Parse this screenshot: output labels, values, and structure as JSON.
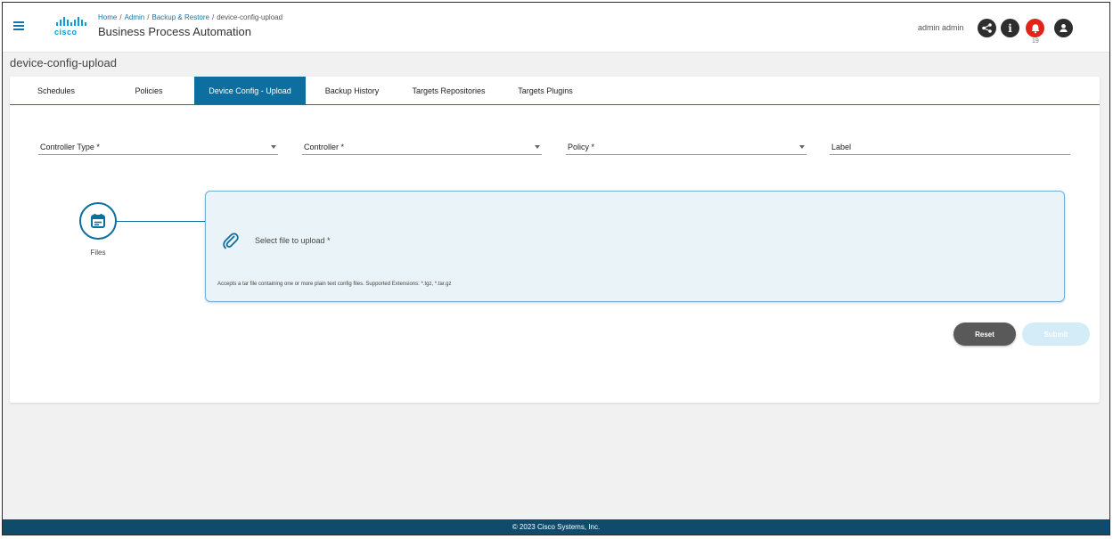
{
  "header": {
    "breadcrumb": {
      "home": "Home",
      "admin": "Admin",
      "backup_restore": "Backup & Restore",
      "current": "device-config-upload",
      "separator": "/"
    },
    "logo_text": "cisco",
    "app_title": "Business Process Automation",
    "user_name": "admin admin",
    "notification_count": "19",
    "info_glyph": "i",
    "icons": [
      "menu-icon",
      "share-icon",
      "info-icon",
      "bell-icon",
      "user-icon"
    ]
  },
  "page": {
    "title": "device-config-upload"
  },
  "tabs": [
    {
      "label": "Schedules",
      "active": false
    },
    {
      "label": "Policies",
      "active": false
    },
    {
      "label": "Device Config - Upload",
      "active": true
    },
    {
      "label": "Backup History",
      "active": false
    },
    {
      "label": "Targets Repositories",
      "active": false
    },
    {
      "label": "Targets Plugins",
      "active": false
    }
  ],
  "form": {
    "controller_type": {
      "label": "Controller Type *",
      "value": ""
    },
    "controller": {
      "label": "Controller *",
      "value": ""
    },
    "policy": {
      "label": "Policy *",
      "value": ""
    },
    "label": {
      "label": "Label",
      "value": ""
    }
  },
  "upload": {
    "step_label": "Files",
    "select_text": "Select file to upload *",
    "accept_text": "Accepts a tar file containing one or more plain text config files. Supported Extensions: *.tgz, *.tar.gz"
  },
  "buttons": {
    "reset": "Reset",
    "submit": "Submit"
  },
  "footer": {
    "copyright": "© 2023 Cisco Systems, Inc."
  },
  "colors": {
    "primary": "#0d6fa0",
    "cisco_blue": "#049fd9",
    "alert_red": "#e2231a",
    "footer_bg": "#0f4c6b",
    "dropzone_bg": "#eaf3f8"
  }
}
